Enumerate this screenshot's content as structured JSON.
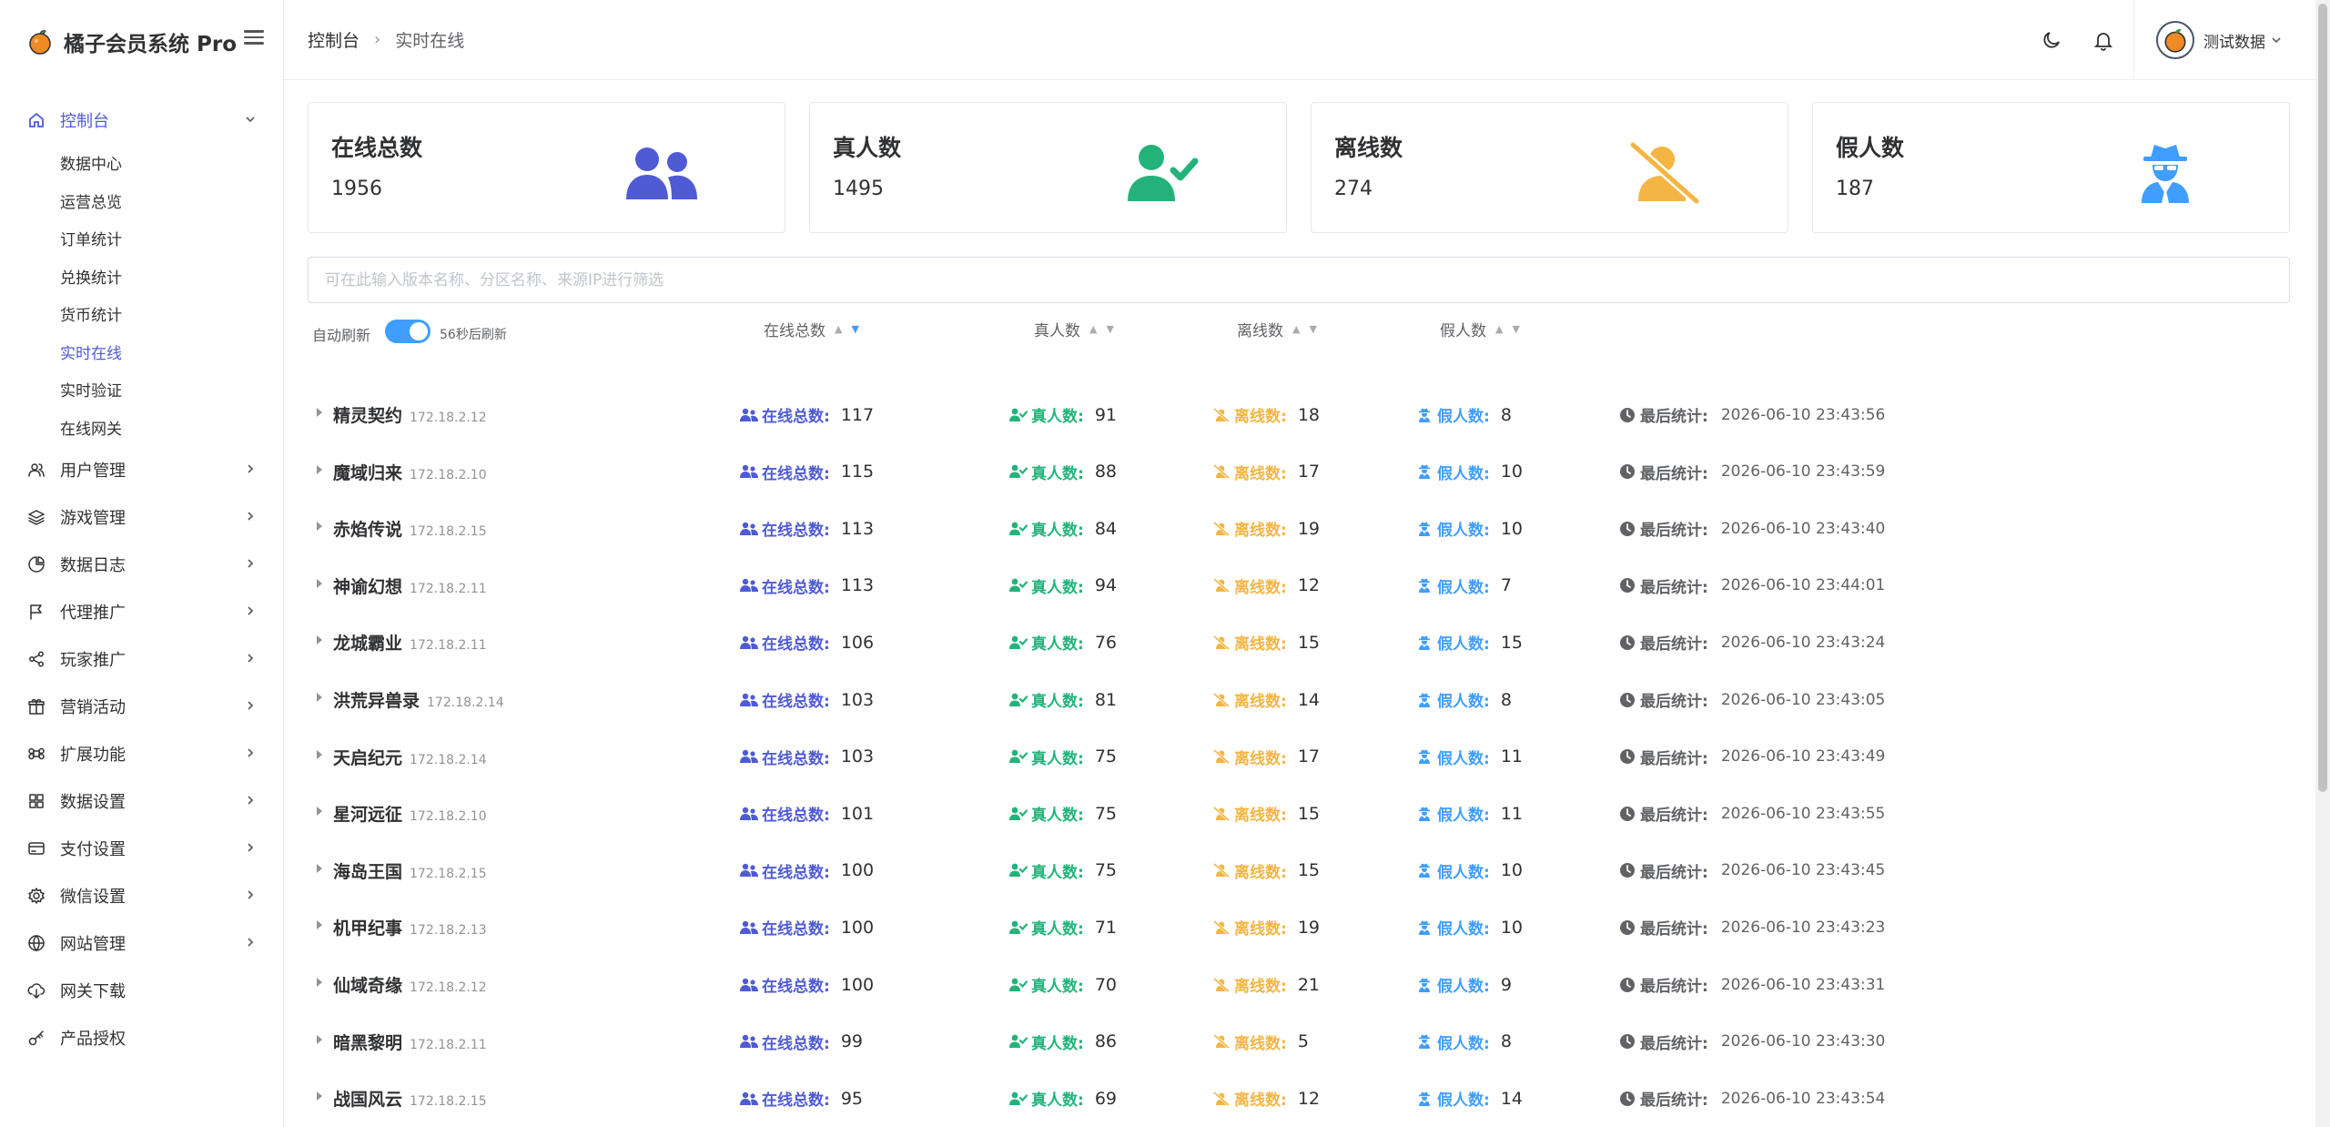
{
  "app": {
    "title": "橘子会员系统 Pro"
  },
  "sidebar": {
    "dashboard": {
      "label": "控制台",
      "children": [
        "数据中心",
        "运营总览",
        "订单统计",
        "兑换统计",
        "货币统计",
        "实时在线",
        "实时验证",
        "在线网关"
      ],
      "active_child": 5
    },
    "items": [
      {
        "label": "用户管理",
        "icon": "users-icon",
        "has_arrow": true
      },
      {
        "label": "游戏管理",
        "icon": "layers-icon",
        "has_arrow": true
      },
      {
        "label": "数据日志",
        "icon": "pie-chart-icon",
        "has_arrow": true
      },
      {
        "label": "代理推广",
        "icon": "flag-icon",
        "has_arrow": true
      },
      {
        "label": "玩家推广",
        "icon": "share-icon",
        "has_arrow": true
      },
      {
        "label": "营销活动",
        "icon": "gift-icon",
        "has_arrow": true
      },
      {
        "label": "扩展功能",
        "icon": "command-icon",
        "has_arrow": true
      },
      {
        "label": "数据设置",
        "icon": "grid-icon",
        "has_arrow": true
      },
      {
        "label": "支付设置",
        "icon": "credit-card-icon",
        "has_arrow": true
      },
      {
        "label": "微信设置",
        "icon": "settings-icon",
        "has_arrow": true
      },
      {
        "label": "网站管理",
        "icon": "globe-icon",
        "has_arrow": true
      },
      {
        "label": "网关下载",
        "icon": "cloud-download-icon",
        "has_arrow": false
      },
      {
        "label": "产品授权",
        "icon": "key-icon",
        "has_arrow": false
      }
    ]
  },
  "header": {
    "breadcrumb": [
      "控制台",
      "实时在线"
    ],
    "user_name": "测试数据"
  },
  "cards": [
    {
      "title": "在线总数",
      "value": "1956",
      "icon": "users-icon",
      "color": "#4f5bd5"
    },
    {
      "title": "真人数",
      "value": "1495",
      "icon": "user-check-icon",
      "color": "#23b37a"
    },
    {
      "title": "离线数",
      "value": "274",
      "icon": "user-slash-icon",
      "color": "#f5b542"
    },
    {
      "title": "假人数",
      "value": "187",
      "icon": "user-secret-icon",
      "color": "#409eff"
    }
  ],
  "search": {
    "placeholder": "可在此输入版本名称、分区名称、来源IP进行筛选",
    "value": ""
  },
  "toolbar": {
    "auto_refresh_label": "自动刷新",
    "auto_refresh_on": true,
    "refresh_text": "56秒后刷新",
    "sort_headers": [
      {
        "label": "在线总数",
        "active": "desc"
      },
      {
        "label": "真人数",
        "active": ""
      },
      {
        "label": "离线数",
        "active": ""
      },
      {
        "label": "假人数",
        "active": ""
      }
    ]
  },
  "labels": {
    "online": "在线总数:",
    "real": "真人数:",
    "offline": "离线数:",
    "fake": "假人数:",
    "last": "最后统计:"
  },
  "colors": {
    "online": "#4f5bd5",
    "real": "#23b37a",
    "offline": "#f5b542",
    "fake": "#409eff",
    "accent": "#409eff"
  },
  "rows": [
    {
      "name": "精灵契约",
      "ip": "172.18.2.12",
      "online": 117,
      "real": 91,
      "offline": 18,
      "fake": 8,
      "time": "2026-06-10 23:43:56"
    },
    {
      "name": "魔域归来",
      "ip": "172.18.2.10",
      "online": 115,
      "real": 88,
      "offline": 17,
      "fake": 10,
      "time": "2026-06-10 23:43:59"
    },
    {
      "name": "赤焰传说",
      "ip": "172.18.2.15",
      "online": 113,
      "real": 84,
      "offline": 19,
      "fake": 10,
      "time": "2026-06-10 23:43:40"
    },
    {
      "name": "神谕幻想",
      "ip": "172.18.2.11",
      "online": 113,
      "real": 94,
      "offline": 12,
      "fake": 7,
      "time": "2026-06-10 23:44:01"
    },
    {
      "name": "龙城霸业",
      "ip": "172.18.2.11",
      "online": 106,
      "real": 76,
      "offline": 15,
      "fake": 15,
      "time": "2026-06-10 23:43:24"
    },
    {
      "name": "洪荒异兽录",
      "ip": "172.18.2.14",
      "online": 103,
      "real": 81,
      "offline": 14,
      "fake": 8,
      "time": "2026-06-10 23:43:05"
    },
    {
      "name": "天启纪元",
      "ip": "172.18.2.14",
      "online": 103,
      "real": 75,
      "offline": 17,
      "fake": 11,
      "time": "2026-06-10 23:43:49"
    },
    {
      "name": "星河远征",
      "ip": "172.18.2.10",
      "online": 101,
      "real": 75,
      "offline": 15,
      "fake": 11,
      "time": "2026-06-10 23:43:55"
    },
    {
      "name": "海岛王国",
      "ip": "172.18.2.15",
      "online": 100,
      "real": 75,
      "offline": 15,
      "fake": 10,
      "time": "2026-06-10 23:43:45"
    },
    {
      "name": "机甲纪事",
      "ip": "172.18.2.13",
      "online": 100,
      "real": 71,
      "offline": 19,
      "fake": 10,
      "time": "2026-06-10 23:43:23"
    },
    {
      "name": "仙域奇缘",
      "ip": "172.18.2.12",
      "online": 100,
      "real": 70,
      "offline": 21,
      "fake": 9,
      "time": "2026-06-10 23:43:31"
    },
    {
      "name": "暗黑黎明",
      "ip": "172.18.2.11",
      "online": 99,
      "real": 86,
      "offline": 5,
      "fake": 8,
      "time": "2026-06-10 23:43:30"
    },
    {
      "name": "战国风云",
      "ip": "172.18.2.15",
      "online": 95,
      "real": 69,
      "offline": 12,
      "fake": 14,
      "time": "2026-06-10 23:43:54"
    }
  ]
}
